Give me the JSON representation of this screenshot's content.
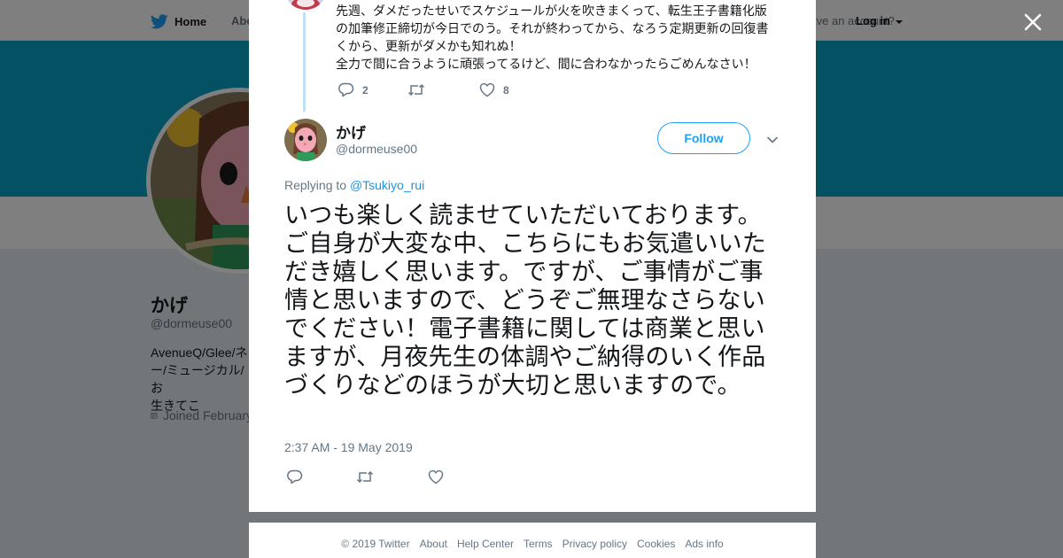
{
  "topnav": {
    "home_label": "Home",
    "about_label": "About",
    "account_text": "Have an account?",
    "login_label": "Log in"
  },
  "profile": {
    "name": "かげ",
    "handle": "@dormeuse00",
    "bio": "AvenueQ/Glee/ネ\nー/ミュージカル/お\n生きてこ",
    "joined": "Joined February"
  },
  "previous_tweet": {
    "text": "先週、ダメだったせいでスケジュールが火を吹きまくって、転生王子書籍化版\nの加筆修正締切が今日でのう。それが終わってから、なろう定期更新の回復書\nくから、更新がダメかも知れぬ！\n全力で間に合うように頑張ってるけど、間に合わなかったらごめんなさい！",
    "reply_count": "2",
    "retweet_count": "",
    "like_count": "8"
  },
  "tweet": {
    "author_name": "かげ",
    "author_handle": "@dormeuse00",
    "follow_label": "Follow",
    "replying_prefix": "Replying to",
    "replying_to": "@Tsukiyo_rui",
    "text": "いつも楽しく読ませていただいております。ご自身が大変な中、こちらにもお気遣いいただき嬉しく思います。ですが、ご事情がご事情と思いますので、どうぞご無理なさらないでください！電子書籍に関しては商業と思いますが、月夜先生の体調やご納得のいく作品づくりなどのほうが大切と思いますので。",
    "timestamp": "2:37 AM - 19 May 2019"
  },
  "footer": {
    "links": [
      "© 2019 Twitter",
      "About",
      "Help Center",
      "Terms",
      "Privacy policy",
      "Cookies",
      "Ads info"
    ]
  },
  "colors": {
    "brand": "#1da1f2",
    "banner": "#06a2c4",
    "link": "#1b95e0",
    "secondary_text": "#657786"
  },
  "icons": {
    "logo": "twitter-bird-icon",
    "close": "close-icon",
    "reply": "reply-icon",
    "retweet": "retweet-icon",
    "like": "heart-icon",
    "more": "chevron-down-icon",
    "calendar": "calendar-icon"
  }
}
